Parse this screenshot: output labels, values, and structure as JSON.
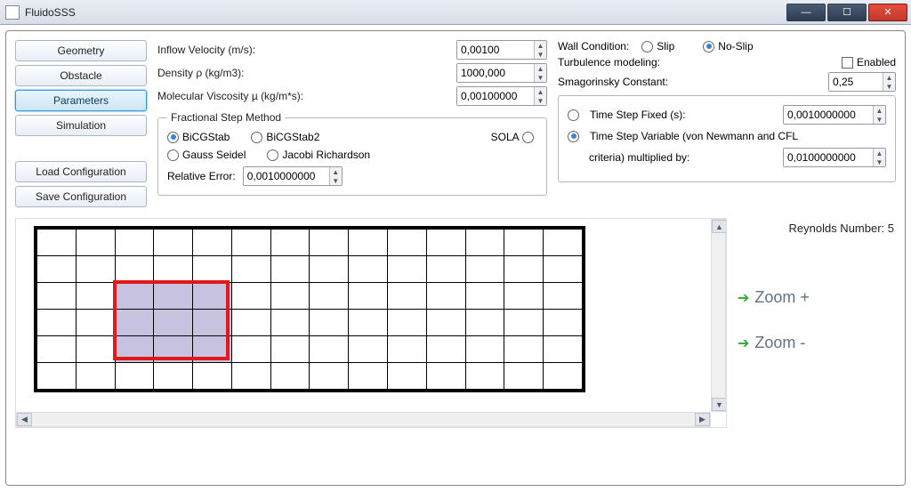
{
  "titlebar": {
    "title": "FluidoSSS"
  },
  "sidebar": {
    "items": [
      {
        "label": "Geometry"
      },
      {
        "label": "Obstacle"
      },
      {
        "label": "Parameters"
      },
      {
        "label": "Simulation"
      }
    ],
    "load_label": "Load Configuration",
    "save_label": "Save Configuration"
  },
  "params": {
    "inflow_label": "Inflow Velocity (m/s):",
    "inflow_value": "0,00100",
    "density_label": "Density ρ (kg/m3):",
    "density_value": "1000,000",
    "viscosity_label": "Molecular Viscosity µ (kg/m*s):",
    "viscosity_value": "0,00100000"
  },
  "wall": {
    "label": "Wall Condition:",
    "slip": "Slip",
    "noslip": "No-Slip"
  },
  "turb": {
    "label": "Turbulence modeling:",
    "enabled": "Enabled",
    "smag_label": "Smagorinsky Constant:",
    "smag_value": "0,25"
  },
  "fsm": {
    "legend": "Fractional Step Method",
    "bicg": "BiCGStab",
    "bicg2": "BiCGStab2",
    "sola": "SOLA",
    "gauss": "Gauss Seidel",
    "jacobi": "Jacobi Richardson",
    "relerr_label": "Relative Error:",
    "relerr_value": "0,0010000000"
  },
  "timestep": {
    "fixed_label": "Time Step Fixed (s):",
    "fixed_value": "0,0010000000",
    "var_label": "Time Step Variable (von Newmann and CFL",
    "var_label2": "criteria) multiplied by:",
    "var_value": "0,0100000000"
  },
  "zoom": {
    "reynolds": "Reynolds Number: 5",
    "in": "Zoom +",
    "out": "Zoom -"
  }
}
